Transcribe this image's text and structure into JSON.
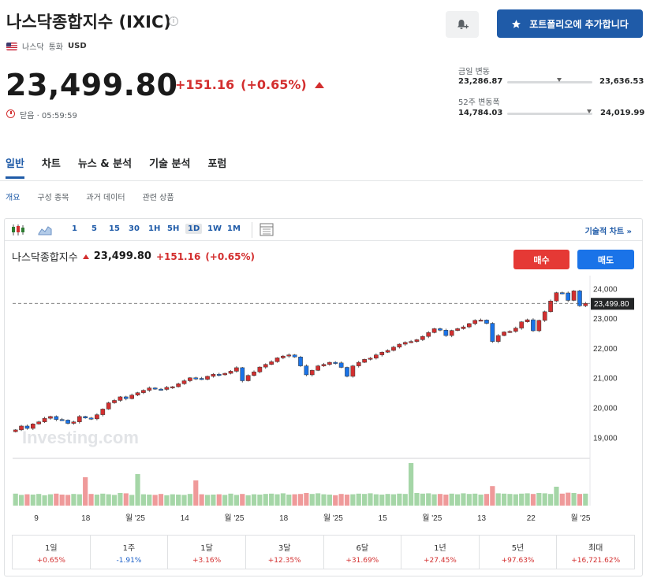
{
  "header": {
    "title": "나스닥종합지수 (IXIC)",
    "info_icon": "i",
    "exchange": "나스닥",
    "currency_label": "통화",
    "currency": "USD",
    "price": "23,499.80",
    "change": "+151.16",
    "change_pct": "(+0.65%)",
    "status": "닫음 · 05:59:59",
    "add_portfolio": "포트폴리오에 추가합니다"
  },
  "ranges": {
    "day_label": "금일 변동",
    "day_low": "23,286.87",
    "day_high": "23,636.53",
    "week52_label": "52주 변동폭",
    "week52_low": "14,784.03",
    "week52_high": "24,019.99"
  },
  "tabs": [
    "일반",
    "차트",
    "뉴스 & 분석",
    "기술 분석",
    "포럼"
  ],
  "subtabs": [
    "개요",
    "구성 종목",
    "과거 데이터",
    "관련 상품"
  ],
  "toolbar": {
    "timeframes": [
      "1",
      "5",
      "15",
      "30",
      "1H",
      "5H",
      "1D",
      "1W",
      "1M"
    ],
    "selected": "1D",
    "tech_chart": "기술적 차트 »"
  },
  "chart_header": {
    "name": "나스닥종합지수",
    "price": "23,499.80",
    "change": "+151.16",
    "change_pct": "(+0.65%)",
    "buy": "매수",
    "sell": "매도"
  },
  "watermark": "Investing.com",
  "colors": {
    "up": "#d32f2f",
    "down": "#1a73e8",
    "accent": "#1f5ba8"
  },
  "chart_data": {
    "type": "candlestick",
    "y_ticks": [
      19000,
      20000,
      21000,
      22000,
      23000,
      24000
    ],
    "ylim": [
      18400,
      24300
    ],
    "last_price": 23499.8,
    "last_price_label": "23,499.80",
    "x_ticks": [
      "9",
      "18",
      "월 '25",
      "14",
      "월 '25",
      "18",
      "월 '25",
      "15",
      "월 '25",
      "13",
      "22",
      "월 '25"
    ],
    "closes": [
      19250,
      19380,
      19300,
      19450,
      19520,
      19640,
      19700,
      19600,
      19580,
      19470,
      19520,
      19700,
      19650,
      19620,
      19760,
      19950,
      20160,
      20240,
      20360,
      20300,
      20420,
      20500,
      20580,
      20660,
      20620,
      20610,
      20680,
      20700,
      20800,
      20900,
      21000,
      20980,
      20950,
      21050,
      21120,
      21100,
      21150,
      21220,
      21340,
      20900,
      21080,
      21200,
      21360,
      21450,
      21540,
      21670,
      21730,
      21770,
      21700,
      21400,
      21100,
      21250,
      21400,
      21450,
      21520,
      21500,
      21350,
      21050,
      21400,
      21520,
      21620,
      21660,
      21770,
      21860,
      21920,
      22030,
      22130,
      22190,
      22220,
      22280,
      22390,
      22520,
      22650,
      22600,
      22420,
      22590,
      22650,
      22710,
      22820,
      22930,
      22940,
      22830,
      22220,
      22420,
      22540,
      22560,
      22670,
      22880,
      22950,
      22580,
      22930,
      23220,
      23580,
      23860,
      23850,
      23600,
      23920,
      23420,
      23500
    ],
    "volumes": [
      0.38,
      0.34,
      0.36,
      0.35,
      0.37,
      0.33,
      0.36,
      0.38,
      0.35,
      0.34,
      0.37,
      0.36,
      0.9,
      0.37,
      0.35,
      0.38,
      0.36,
      0.34,
      0.4,
      0.39,
      0.34,
      1.0,
      0.36,
      0.35,
      0.34,
      0.37,
      0.33,
      0.36,
      0.35,
      0.34,
      0.37,
      0.8,
      0.36,
      0.34,
      0.35,
      0.36,
      0.34,
      0.38,
      0.34,
      0.37,
      0.33,
      0.36,
      0.35,
      0.37,
      0.38,
      0.36,
      0.39,
      0.35,
      0.36,
      0.37,
      0.4,
      0.37,
      0.39,
      0.36,
      0.35,
      0.33,
      0.37,
      0.35,
      0.36,
      0.38,
      0.37,
      0.39,
      0.36,
      0.35,
      0.37,
      0.36,
      0.38,
      0.37,
      1.35,
      0.4,
      0.38,
      0.39,
      0.36,
      0.37,
      0.35,
      0.38,
      0.36,
      0.39,
      0.37,
      0.38,
      0.35,
      0.37,
      0.62,
      0.39,
      0.38,
      0.37,
      0.36,
      0.38,
      0.39,
      0.37,
      0.4,
      0.39,
      0.37,
      0.6,
      0.38,
      0.41,
      0.4,
      0.37,
      0.38
    ]
  },
  "performance": [
    {
      "label": "1일",
      "value": "+0.65%",
      "dir": "pos"
    },
    {
      "label": "1주",
      "value": "-1.91%",
      "dir": "neg"
    },
    {
      "label": "1달",
      "value": "+3.16%",
      "dir": "pos"
    },
    {
      "label": "3달",
      "value": "+12.35%",
      "dir": "pos"
    },
    {
      "label": "6달",
      "value": "+31.69%",
      "dir": "pos"
    },
    {
      "label": "1년",
      "value": "+27.45%",
      "dir": "pos"
    },
    {
      "label": "5년",
      "value": "+97.63%",
      "dir": "pos"
    },
    {
      "label": "최대",
      "value": "+16,721.62%",
      "dir": "pos"
    }
  ]
}
